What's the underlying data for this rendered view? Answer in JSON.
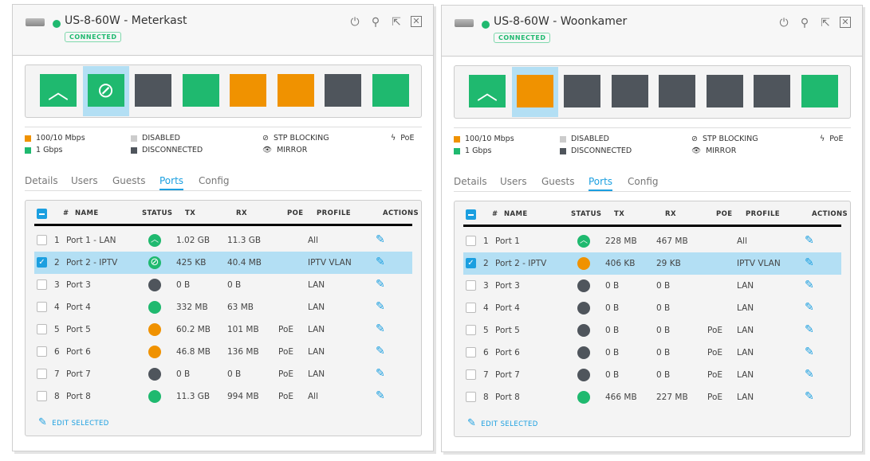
{
  "colors": {
    "green": "#1fb96f",
    "orange": "#f09200",
    "dark": "#4f555c",
    "disabled": "#cccccc",
    "accent": "#1b9fe0"
  },
  "legend": {
    "fast": "100/10 Mbps",
    "gig": "1 Gbps",
    "disabled": "DISABLED",
    "disconnected": "DISCONNECTED",
    "stp": "STP BLOCKING",
    "mirror": "MIRROR",
    "poe": "PoE"
  },
  "tabs": [
    "Details",
    "Users",
    "Guests",
    "Ports",
    "Config"
  ],
  "active_tab": "Ports",
  "columns": [
    "#",
    "NAME",
    "STATUS",
    "TX",
    "RX",
    "POE",
    "PROFILE",
    "ACTIONS"
  ],
  "edit_selected": "EDIT SELECTED",
  "panels": [
    {
      "title": "US-8-60W - Meterkast",
      "status": "CONNECTED",
      "selected_port": 2,
      "ports": [
        {
          "n": "1",
          "name": "Port 1 - LAN",
          "status": "uplink",
          "color": "green",
          "tx": "1.02 GB",
          "rx": "11.3 GB",
          "poe": "",
          "profile": "All",
          "checked": false
        },
        {
          "n": "2",
          "name": "Port 2 - IPTV",
          "status": "stp",
          "color": "green",
          "tx": "425 KB",
          "rx": "40.4 MB",
          "poe": "",
          "profile": "IPTV VLAN",
          "checked": true
        },
        {
          "n": "3",
          "name": "Port 3",
          "status": "dot",
          "color": "dark",
          "tx": "0 B",
          "rx": "0 B",
          "poe": "",
          "profile": "LAN",
          "checked": false
        },
        {
          "n": "4",
          "name": "Port 4",
          "status": "dot",
          "color": "green",
          "tx": "332 MB",
          "rx": "63 MB",
          "poe": "",
          "profile": "LAN",
          "checked": false
        },
        {
          "n": "5",
          "name": "Port 5",
          "status": "dot",
          "color": "orange",
          "tx": "60.2 MB",
          "rx": "101 MB",
          "poe": "PoE",
          "profile": "LAN",
          "checked": false
        },
        {
          "n": "6",
          "name": "Port 6",
          "status": "dot",
          "color": "orange",
          "tx": "46.8 MB",
          "rx": "136 MB",
          "poe": "PoE",
          "profile": "LAN",
          "checked": false
        },
        {
          "n": "7",
          "name": "Port 7",
          "status": "dot",
          "color": "dark",
          "tx": "0 B",
          "rx": "0 B",
          "poe": "PoE",
          "profile": "LAN",
          "checked": false
        },
        {
          "n": "8",
          "name": "Port 8",
          "status": "dot",
          "color": "green",
          "tx": "11.3 GB",
          "rx": "994 MB",
          "poe": "PoE",
          "profile": "All",
          "checked": false
        }
      ]
    },
    {
      "title": "US-8-60W - Woonkamer",
      "status": "CONNECTED",
      "selected_port": 2,
      "ports": [
        {
          "n": "1",
          "name": "Port 1",
          "status": "uplink",
          "color": "green",
          "tx": "228 MB",
          "rx": "467 MB",
          "poe": "",
          "profile": "All",
          "checked": false
        },
        {
          "n": "2",
          "name": "Port 2 - IPTV",
          "status": "dot",
          "color": "orange",
          "tx": "406 KB",
          "rx": "29 KB",
          "poe": "",
          "profile": "IPTV VLAN",
          "checked": true
        },
        {
          "n": "3",
          "name": "Port 3",
          "status": "dot",
          "color": "dark",
          "tx": "0 B",
          "rx": "0 B",
          "poe": "",
          "profile": "LAN",
          "checked": false
        },
        {
          "n": "4",
          "name": "Port 4",
          "status": "dot",
          "color": "dark",
          "tx": "0 B",
          "rx": "0 B",
          "poe": "",
          "profile": "LAN",
          "checked": false
        },
        {
          "n": "5",
          "name": "Port 5",
          "status": "dot",
          "color": "dark",
          "tx": "0 B",
          "rx": "0 B",
          "poe": "PoE",
          "profile": "LAN",
          "checked": false
        },
        {
          "n": "6",
          "name": "Port 6",
          "status": "dot",
          "color": "dark",
          "tx": "0 B",
          "rx": "0 B",
          "poe": "PoE",
          "profile": "LAN",
          "checked": false
        },
        {
          "n": "7",
          "name": "Port 7",
          "status": "dot",
          "color": "dark",
          "tx": "0 B",
          "rx": "0 B",
          "poe": "PoE",
          "profile": "LAN",
          "checked": false
        },
        {
          "n": "8",
          "name": "Port 8",
          "status": "dot",
          "color": "green",
          "tx": "466 MB",
          "rx": "227 MB",
          "poe": "PoE",
          "profile": "LAN",
          "checked": false
        }
      ]
    }
  ]
}
